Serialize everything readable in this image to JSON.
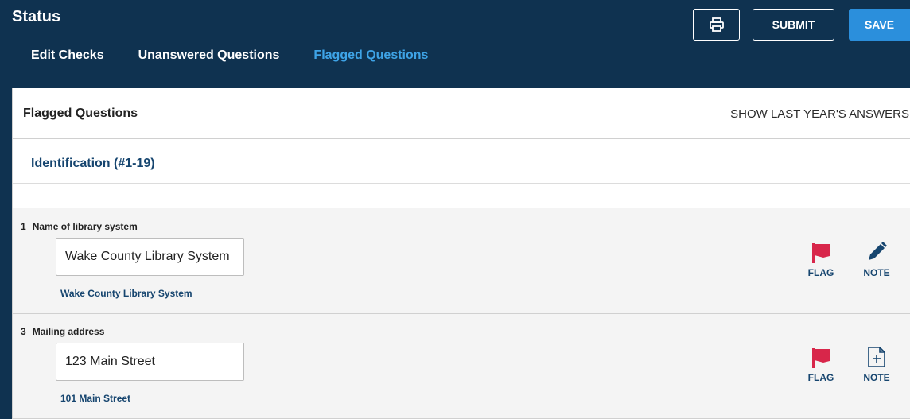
{
  "header": {
    "title": "Status",
    "tabs": [
      {
        "label": "Edit Checks"
      },
      {
        "label": "Unanswered Questions"
      },
      {
        "label": "Flagged Questions"
      }
    ],
    "active_tab": "Flagged Questions",
    "print_icon": "printer-icon",
    "submit_label": "SUBMIT",
    "save_label": "SAVE"
  },
  "card": {
    "title": "Flagged Questions",
    "show_last_label": "SHOW LAST YEAR'S ANSWERS"
  },
  "section": {
    "title": "Identification (#1-19)"
  },
  "questions": [
    {
      "number": "1",
      "label": "Name of library system",
      "value": "Wake County Library System",
      "previous": "Wake County Library System",
      "flag_label": "FLAG",
      "flag_icon": "flag-icon",
      "note_label": "NOTE",
      "note_icon": "pencil-icon"
    },
    {
      "number": "3",
      "label": "Mailing address",
      "value": "123 Main Street",
      "previous": "101 Main Street",
      "flag_label": "FLAG",
      "flag_icon": "flag-icon",
      "note_label": "NOTE",
      "note_icon": "add-note-icon"
    }
  ],
  "colors": {
    "header_bg": "#0f3250",
    "accent": "#2b8fdc",
    "active_tab": "#3ea3e6",
    "flag": "#d8264a",
    "text_link": "#16456f"
  }
}
